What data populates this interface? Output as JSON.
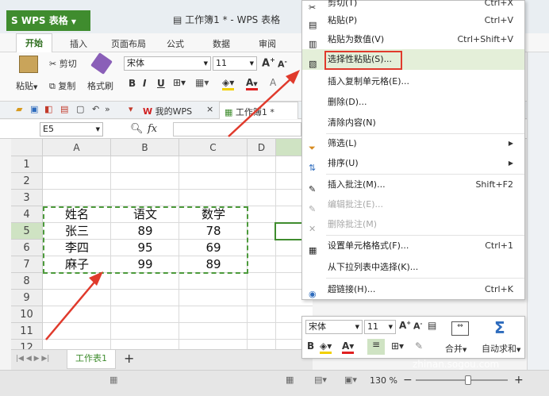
{
  "app": {
    "button": "WPS 表格",
    "doc_title": "工作簿1 * - WPS 表格"
  },
  "ribbon_tabs": [
    "开始",
    "插入",
    "页面布局",
    "公式",
    "数据",
    "审阅"
  ],
  "ribbon": {
    "paste": "粘贴",
    "cut": "剪切",
    "copy": "复制",
    "format_painter": "格式刷",
    "font_name": "宋体",
    "font_size": "11",
    "bold": "B",
    "italic": "I",
    "underline": "U",
    "font_color": "A"
  },
  "doc_tabs": {
    "wps_tab": "我的WPS",
    "close": "×",
    "doc_tab": "工作簿1 *"
  },
  "formula_bar": {
    "cell_ref": "E5",
    "fx": "fx"
  },
  "columns": [
    "A",
    "B",
    "C",
    "D"
  ],
  "rows": [
    "1",
    "2",
    "3",
    "4",
    "5",
    "6",
    "7",
    "8",
    "9",
    "10",
    "11",
    "12"
  ],
  "table": {
    "header": [
      "姓名",
      "语文",
      "数学"
    ],
    "rows": [
      [
        "张三",
        "89",
        "78"
      ],
      [
        "李四",
        "95",
        "69"
      ],
      [
        "麻子",
        "99",
        "89"
      ]
    ]
  },
  "sheet": {
    "tab": "工作表1",
    "add": "+"
  },
  "status": {
    "zoom": "130 %",
    "minus": "−",
    "plus": "+"
  },
  "context_menu": {
    "items": [
      {
        "label": "剪切(T)",
        "shortcut": "Ctrl+X"
      },
      {
        "label": "粘贴(P)",
        "shortcut": "Ctrl+V"
      },
      {
        "label": "粘贴为数值(V)",
        "shortcut": "Ctrl+Shift+V"
      },
      {
        "label": "选择性粘贴(S)...",
        "shortcut": ""
      },
      {
        "label": "插入复制单元格(E)...",
        "shortcut": ""
      },
      {
        "label": "删除(D)...",
        "shortcut": ""
      },
      {
        "label": "清除内容(N)",
        "shortcut": ""
      },
      {
        "label": "筛选(L)",
        "shortcut": ""
      },
      {
        "label": "排序(U)",
        "shortcut": ""
      },
      {
        "label": "插入批注(M)...",
        "shortcut": "Shift+F2"
      },
      {
        "label": "编辑批注(E)...",
        "shortcut": ""
      },
      {
        "label": "删除批注(M)",
        "shortcut": ""
      },
      {
        "label": "设置单元格格式(F)...",
        "shortcut": "Ctrl+1"
      },
      {
        "label": "从下拉列表中选择(K)...",
        "shortcut": ""
      },
      {
        "label": "超链接(H)...",
        "shortcut": "Ctrl+K"
      }
    ]
  },
  "mini_toolbar": {
    "font_name": "宋体",
    "font_size": "11",
    "merge": "合并",
    "autosum": "自动求和"
  },
  "watermark": "zhinan.sogou.com",
  "colors": {
    "accent_green": "#3f8c2e",
    "highlight_red": "#e03a2c",
    "hover_green": "#e4efd9",
    "dash_green": "#4c9a3b"
  }
}
